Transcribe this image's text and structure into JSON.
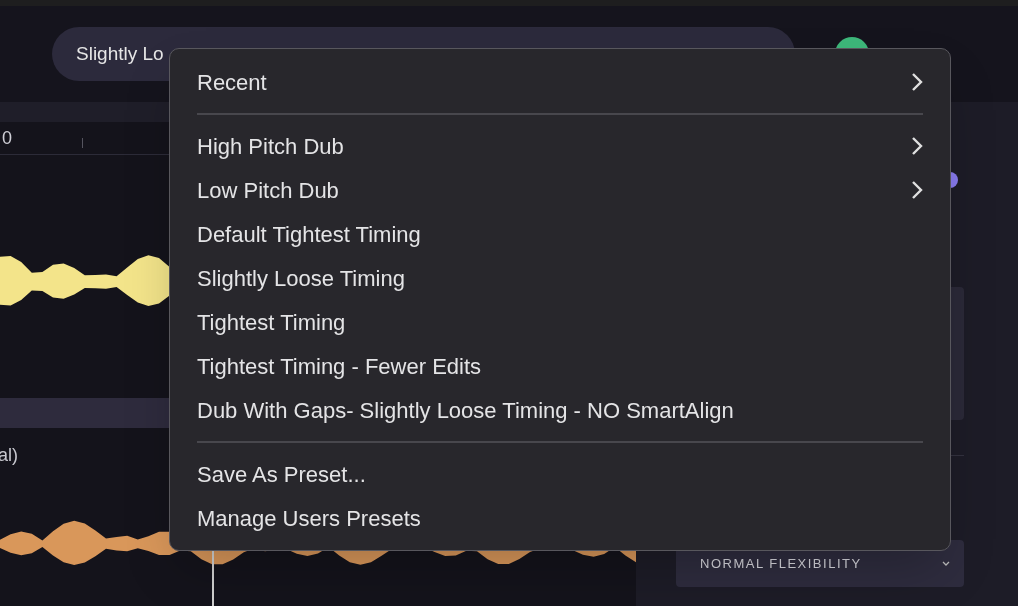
{
  "preset_field": {
    "value": "Slightly Lo"
  },
  "ruler": {
    "labels": [
      "0"
    ]
  },
  "tracks": [
    {
      "color": "#f3e48a"
    },
    {
      "label": "al)",
      "color": "#d9975a"
    }
  ],
  "right_panel": {
    "flexibility_dropdown": {
      "value": "NORMAL FLEXIBILITY"
    }
  },
  "menu": {
    "sections": [
      [
        {
          "label": "Recent",
          "has_submenu": true
        }
      ],
      [
        {
          "label": "High Pitch Dub",
          "has_submenu": true
        },
        {
          "label": "Low Pitch Dub",
          "has_submenu": true
        },
        {
          "label": "Default Tightest Timing",
          "has_submenu": false
        },
        {
          "label": "Slightly Loose Timing",
          "has_submenu": false
        },
        {
          "label": "Tightest Timing",
          "has_submenu": false
        },
        {
          "label": "Tightest Timing - Fewer Edits",
          "has_submenu": false
        },
        {
          "label": "Dub With Gaps- Slightly Loose Timing - NO SmartAlign",
          "has_submenu": false
        }
      ],
      [
        {
          "label": "Save As Preset...",
          "has_submenu": false
        },
        {
          "label": "Manage Users Presets",
          "has_submenu": false
        }
      ]
    ]
  }
}
